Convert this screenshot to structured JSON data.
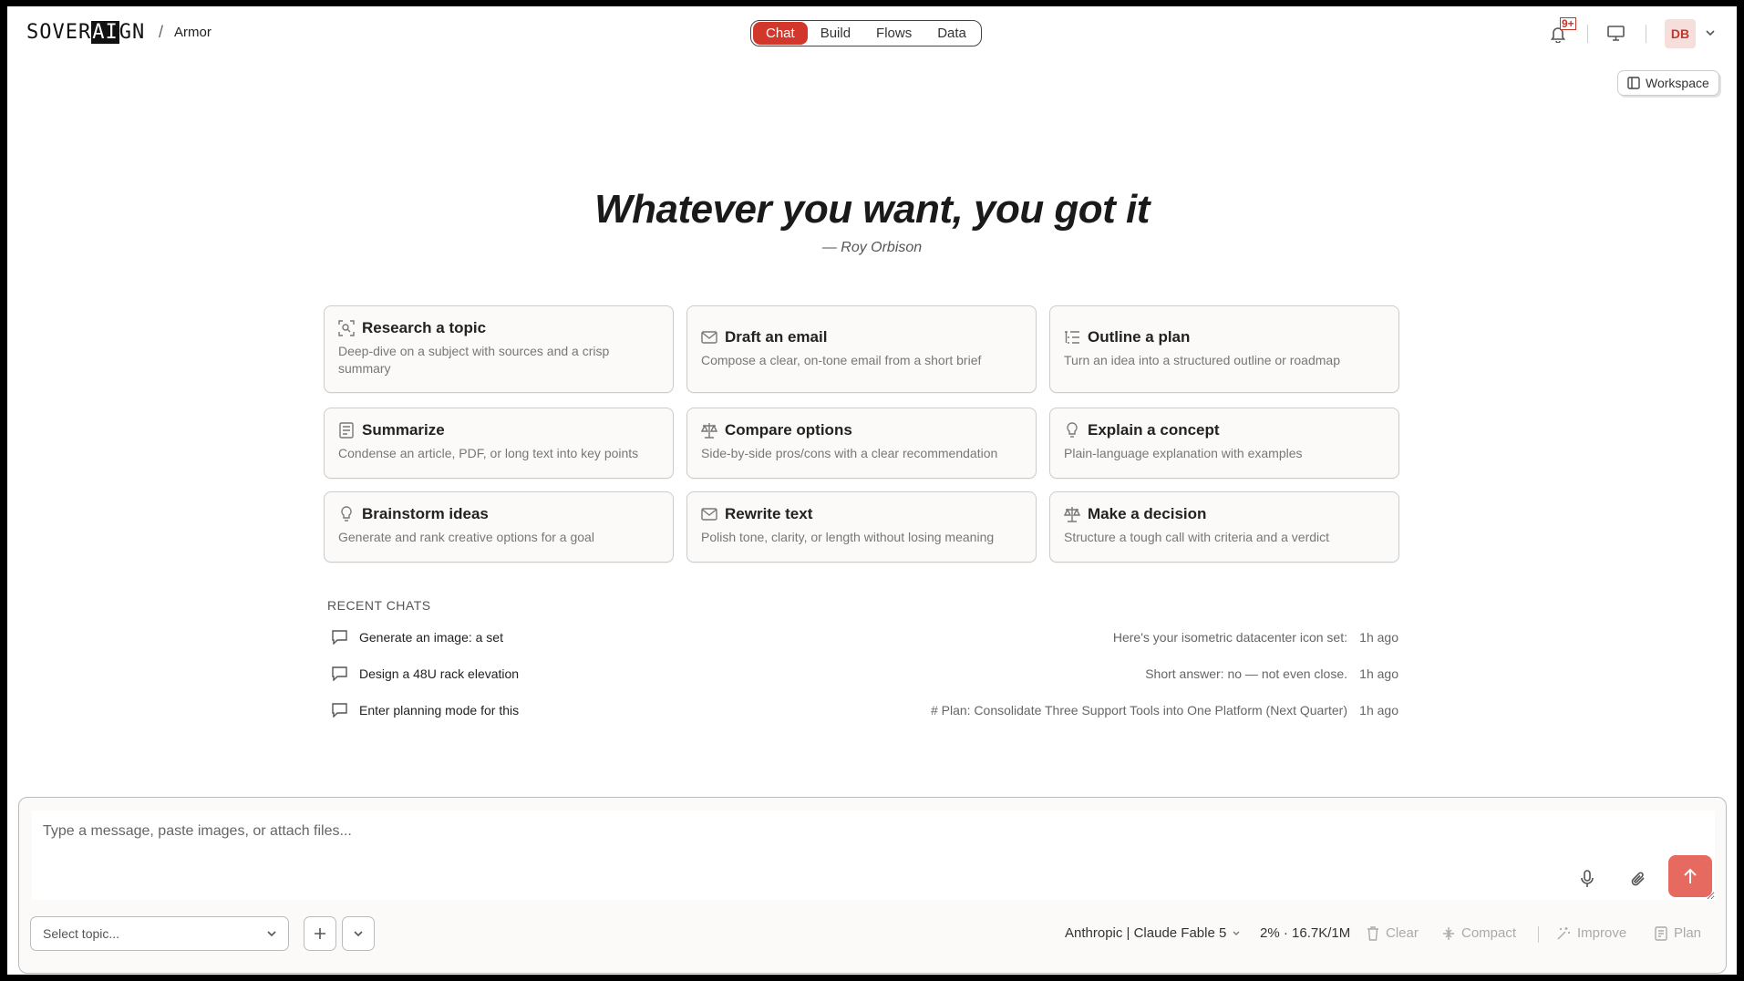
{
  "header": {
    "logo_pre": "SOVER",
    "logo_ai": "AI",
    "logo_post": "GN",
    "breadcrumb_sep": "/",
    "breadcrumb": "Armor",
    "tabs": [
      {
        "label": "Chat",
        "active": true
      },
      {
        "label": "Build",
        "active": false
      },
      {
        "label": "Flows",
        "active": false
      },
      {
        "label": "Data",
        "active": false
      }
    ],
    "notifications_badge": "9+",
    "user_initials": "DB",
    "workspace_label": "Workspace"
  },
  "hero": {
    "title": "Whatever you want, you got it",
    "subtitle": "— Roy Orbison"
  },
  "cards": [
    {
      "icon": "research-icon",
      "title": "Research a topic",
      "desc": "Deep-dive on a subject with sources and a crisp summary"
    },
    {
      "icon": "mail-icon",
      "title": "Draft an email",
      "desc": "Compose a clear, on-tone email from a short brief"
    },
    {
      "icon": "outline-icon",
      "title": "Outline a plan",
      "desc": "Turn an idea into a structured outline or roadmap"
    },
    {
      "icon": "document-icon",
      "title": "Summarize",
      "desc": "Condense an article, PDF, or long text into key points"
    },
    {
      "icon": "scale-icon",
      "title": "Compare options",
      "desc": "Side-by-side pros/cons with a clear recommendation"
    },
    {
      "icon": "lightbulb-icon",
      "title": "Explain a concept",
      "desc": "Plain-language explanation with examples"
    },
    {
      "icon": "lightbulb-icon",
      "title": "Brainstorm ideas",
      "desc": "Generate and rank creative options for a goal"
    },
    {
      "icon": "mail-icon",
      "title": "Rewrite text",
      "desc": "Polish tone, clarity, or length without losing meaning"
    },
    {
      "icon": "scale-icon",
      "title": "Make a decision",
      "desc": "Structure a tough call with criteria and a verdict"
    }
  ],
  "recent": {
    "label": "RECENT CHATS",
    "items": [
      {
        "title": "Generate an image: a set",
        "preview": "Here's your isometric datacenter icon set:",
        "time": "1h ago"
      },
      {
        "title": "Design a 48U rack elevation",
        "preview": "Short answer: no — not even close.",
        "time": "1h ago"
      },
      {
        "title": "Enter planning mode for this",
        "preview": "# Plan: Consolidate Three Support Tools into One Platform (Next Quarter)",
        "time": "1h ago"
      }
    ]
  },
  "composer": {
    "placeholder": "Type a message, paste images, or attach files...",
    "topic_placeholder": "Select topic...",
    "model": "Anthropic | Claude Fable 5",
    "usage": "2% · 16.7K/1M",
    "tools": [
      "Clear",
      "Compact",
      "Improve",
      "Plan"
    ]
  },
  "colors": {
    "accent": "#d2372b",
    "send": "#e66a60"
  }
}
